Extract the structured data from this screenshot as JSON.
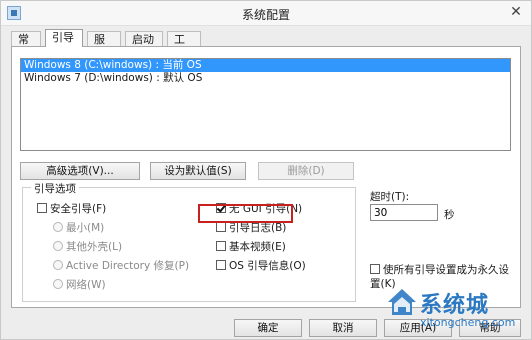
{
  "window": {
    "title": "系统配置",
    "close_label": "✕"
  },
  "tabs": [
    {
      "label": "常规",
      "active": false
    },
    {
      "label": "引导",
      "active": true
    },
    {
      "label": "服务",
      "active": false
    },
    {
      "label": "启动",
      "active": false
    },
    {
      "label": "工具",
      "active": false
    }
  ],
  "os_list": [
    {
      "label": "Windows 8 (C:\\windows) : 当前 OS",
      "selected": true
    },
    {
      "label": "Windows 7 (D:\\windows) : 默认 OS",
      "selected": false
    }
  ],
  "buttons": {
    "advanced": "高级选项(V)...",
    "set_default": "设为默认值(S)",
    "delete": "删除(D)",
    "ok": "确定",
    "cancel": "取消",
    "apply": "应用(A)",
    "help": "帮助"
  },
  "boot_options": {
    "title": "引导选项",
    "safe_boot": {
      "label": "安全引导(F)",
      "checked": false
    },
    "radios": [
      {
        "label": "最小(M)"
      },
      {
        "label": "其他外壳(L)"
      },
      {
        "label": "Active Directory 修复(P)"
      },
      {
        "label": "网络(W)"
      }
    ],
    "no_gui": {
      "label": "无 GUI 引导(N)",
      "checked": true
    },
    "boot_log": {
      "label": "引导日志(B)",
      "checked": false
    },
    "base_video": {
      "label": "基本视频(E)",
      "checked": false
    },
    "os_boot_info": {
      "label": "OS 引导信息(O)",
      "checked": false
    }
  },
  "timeout": {
    "label": "超时(T):",
    "value": "30",
    "unit": "秒"
  },
  "make_permanent": {
    "label": "使所有引导设置成为永久设置(K)",
    "checked": false
  },
  "watermark": {
    "name": "系统城",
    "domain": "xitongcheng.com"
  },
  "colors": {
    "selection": "#3297fd",
    "highlight": "#c8201f",
    "watermark": "#2b79c2"
  }
}
